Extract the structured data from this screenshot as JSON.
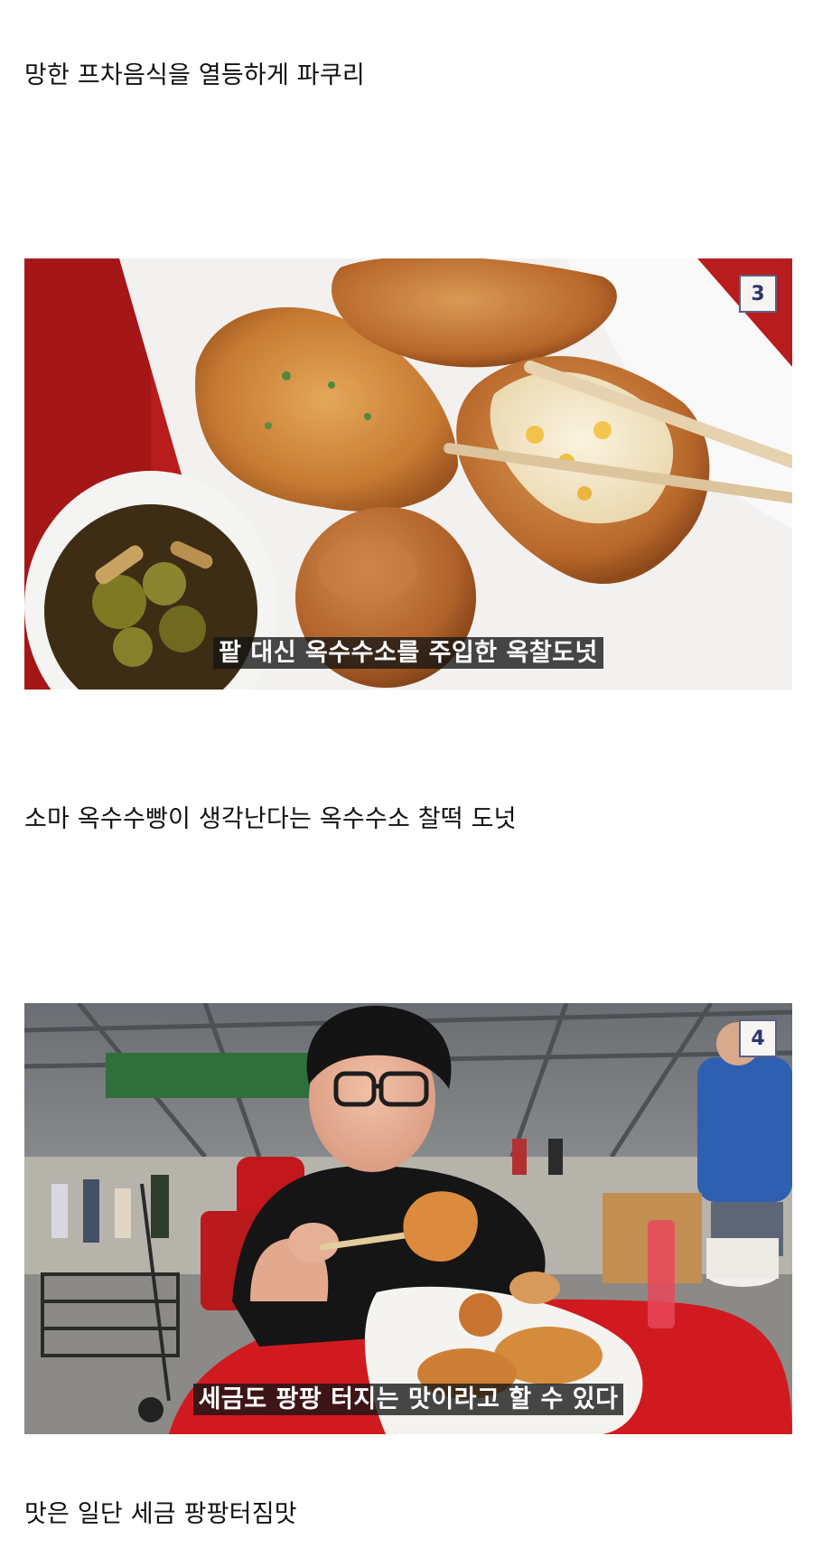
{
  "post": {
    "paragraph_1": "망한 프차음식을 열등하게 파쿠리",
    "paragraph_2": "소마 옥수수빵이 생각난다는 옥수수소 찰떡 도넛",
    "paragraph_3": "맛은 일단 세금 팡팡터짐맛"
  },
  "images": [
    {
      "page_number": "3",
      "subtitle": "팥 대신 옥수수소를 주입한 옥찰도넛",
      "subject": "fried-corn-donuts-and-pickled-peppers"
    },
    {
      "page_number": "4",
      "subtitle": "세금도 팡팡 터지는 맛이라고 할 수 있다",
      "subject": "man-eating-fritter-at-market-stall"
    }
  ],
  "colors": {
    "tablecloth_red": "#b81c1c",
    "badge_border": "#5b5f86",
    "badge_text": "#2e3470"
  }
}
